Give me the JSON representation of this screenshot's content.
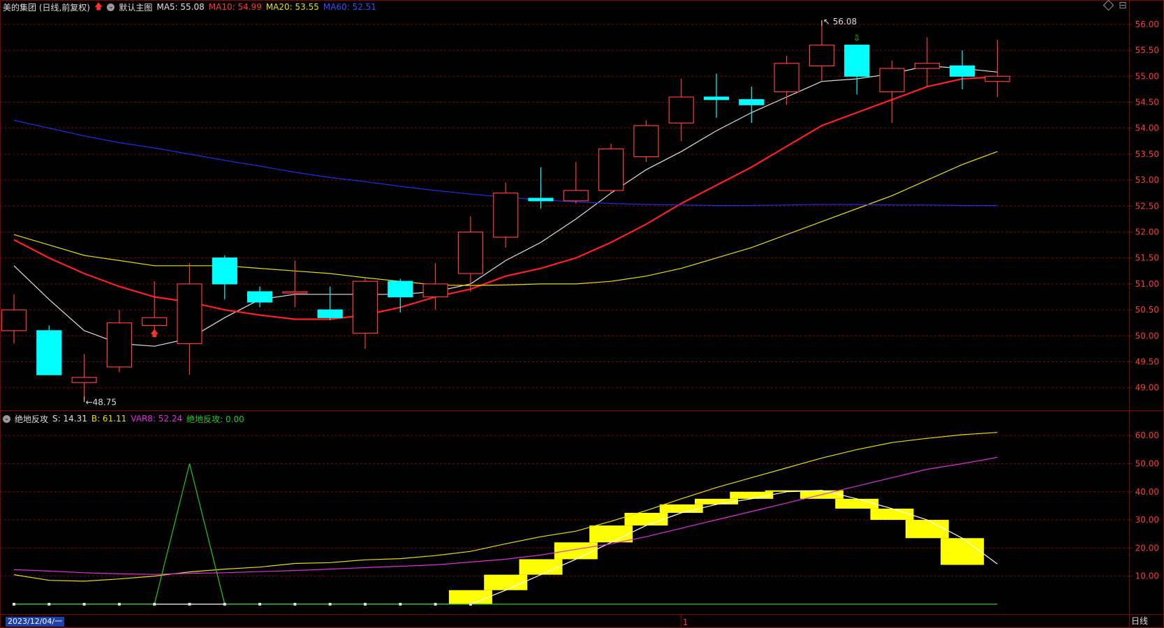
{
  "header": {
    "stock_name": "美的集团 (日线,前复权)",
    "template_name": "默认主图",
    "ma_labels": [
      {
        "text": "MA5: 55.08",
        "color": "#e0e0e0"
      },
      {
        "text": "MA10: 54.99",
        "color": "#ff2a2a"
      },
      {
        "text": "MA20: 53.55",
        "color": "#e8e000"
      },
      {
        "text": "MA60: 52.51",
        "color": "#2a3bff"
      }
    ]
  },
  "indicator_header": {
    "name": "绝地反攻",
    "labels": [
      {
        "text": "S: 14.31",
        "color": "#e0e0e0"
      },
      {
        "text": "B: 61.11",
        "color": "#e8e000"
      },
      {
        "text": "VAR8: 52.24",
        "color": "#e02ee0"
      },
      {
        "text": "绝地反攻: 0.00",
        "color": "#22cc22"
      }
    ]
  },
  "footer": {
    "date_label": "2023/12/04/一",
    "period_label": "日线",
    "divider_label": "1"
  },
  "colors": {
    "up": "#ff3b3b",
    "down": "#00ffff",
    "grid": "#8b0000",
    "axis_text": "#ff3b3b",
    "ma5": "#e0e0e0",
    "ma10": "#ff2020",
    "ma20": "#e8e000",
    "ma60": "#1e2ef0",
    "s_bars": "#ffff00",
    "b_line": "#e8e000",
    "var8": "#e02ee0",
    "jdfg": "#22cc22"
  },
  "chart_data": [
    {
      "type": "candlestick",
      "title": "美的集团 (日线,前复权)",
      "ylim": [
        48.7,
        56.2
      ],
      "yticks": [
        "49.00",
        "49.50",
        "50.00",
        "50.50",
        "51.00",
        "51.50",
        "52.00",
        "52.50",
        "53.00",
        "53.50",
        "54.00",
        "54.50",
        "55.00",
        "55.50",
        "56.00"
      ],
      "annotations": [
        {
          "text": "48.75",
          "x": 2,
          "y": 48.75,
          "kind": "low"
        },
        {
          "text": "56.08",
          "x": 23,
          "y": 56.08,
          "kind": "high"
        }
      ],
      "signals": [
        {
          "x": 4,
          "kind": "buy"
        },
        {
          "x": 24,
          "kind": "sell"
        }
      ],
      "candles": [
        {
          "o": 50.1,
          "h": 50.8,
          "l": 49.85,
          "c": 50.5
        },
        {
          "o": 50.1,
          "h": 50.2,
          "l": 49.25,
          "c": 49.25
        },
        {
          "o": 49.1,
          "h": 49.65,
          "l": 48.75,
          "c": 49.2
        },
        {
          "o": 49.4,
          "h": 50.5,
          "l": 49.3,
          "c": 50.25
        },
        {
          "o": 50.2,
          "h": 51.05,
          "l": 50.05,
          "c": 50.35
        },
        {
          "o": 49.85,
          "h": 51.4,
          "l": 49.25,
          "c": 51.0
        },
        {
          "o": 51.5,
          "h": 51.55,
          "l": 50.7,
          "c": 51.0
        },
        {
          "o": 50.85,
          "h": 50.95,
          "l": 50.55,
          "c": 50.65
        },
        {
          "o": 50.85,
          "h": 51.45,
          "l": 50.55,
          "c": 50.85
        },
        {
          "o": 50.5,
          "h": 50.95,
          "l": 50.3,
          "c": 50.35
        },
        {
          "o": 50.05,
          "h": 51.1,
          "l": 49.75,
          "c": 51.05
        },
        {
          "o": 51.05,
          "h": 51.1,
          "l": 50.45,
          "c": 50.75
        },
        {
          "o": 50.75,
          "h": 51.4,
          "l": 50.5,
          "c": 51.0
        },
        {
          "o": 51.2,
          "h": 52.3,
          "l": 50.85,
          "c": 52.0
        },
        {
          "o": 51.9,
          "h": 52.95,
          "l": 51.7,
          "c": 52.75
        },
        {
          "o": 52.65,
          "h": 53.25,
          "l": 52.45,
          "c": 52.6
        },
        {
          "o": 52.6,
          "h": 53.35,
          "l": 52.55,
          "c": 52.8
        },
        {
          "o": 52.8,
          "h": 53.7,
          "l": 52.75,
          "c": 53.6
        },
        {
          "o": 53.45,
          "h": 54.15,
          "l": 53.35,
          "c": 54.05
        },
        {
          "o": 54.1,
          "h": 54.95,
          "l": 53.75,
          "c": 54.6
        },
        {
          "o": 54.6,
          "h": 55.05,
          "l": 54.2,
          "c": 54.55
        },
        {
          "o": 54.55,
          "h": 54.8,
          "l": 54.1,
          "c": 54.45
        },
        {
          "o": 54.7,
          "h": 55.4,
          "l": 54.45,
          "c": 55.25
        },
        {
          "o": 55.2,
          "h": 56.08,
          "l": 54.9,
          "c": 55.6
        },
        {
          "o": 55.6,
          "h": 55.6,
          "l": 54.65,
          "c": 55.0
        },
        {
          "o": 54.7,
          "h": 55.3,
          "l": 54.1,
          "c": 55.15
        },
        {
          "o": 55.15,
          "h": 55.75,
          "l": 54.8,
          "c": 55.25
        },
        {
          "o": 55.2,
          "h": 55.5,
          "l": 54.75,
          "c": 55.0
        },
        {
          "o": 54.9,
          "h": 55.7,
          "l": 54.6,
          "c": 55.0
        }
      ],
      "series": [
        {
          "name": "MA5",
          "values": [
            51.35,
            50.7,
            50.1,
            49.85,
            49.8,
            49.95,
            50.35,
            50.7,
            50.8,
            50.8,
            50.8,
            50.8,
            50.85,
            51.0,
            51.45,
            51.8,
            52.25,
            52.75,
            53.2,
            53.55,
            53.95,
            54.3,
            54.6,
            54.9,
            54.95,
            55.05,
            55.2,
            55.15,
            55.08
          ]
        },
        {
          "name": "MA10",
          "values": [
            51.85,
            51.5,
            51.2,
            50.95,
            50.75,
            50.65,
            50.5,
            50.4,
            50.32,
            50.32,
            50.4,
            50.55,
            50.75,
            50.9,
            51.15,
            51.3,
            51.5,
            51.8,
            52.15,
            52.55,
            52.9,
            53.25,
            53.65,
            54.05,
            54.3,
            54.55,
            54.8,
            54.95,
            54.99
          ]
        },
        {
          "name": "MA20",
          "values": [
            51.95,
            51.75,
            51.55,
            51.45,
            51.35,
            51.35,
            51.35,
            51.3,
            51.25,
            51.2,
            51.12,
            51.05,
            50.98,
            50.97,
            50.98,
            51.0,
            51.0,
            51.05,
            51.15,
            51.3,
            51.5,
            51.7,
            51.95,
            52.2,
            52.45,
            52.7,
            53.0,
            53.3,
            53.55
          ]
        },
        {
          "name": "MA60",
          "values": [
            54.15,
            54.0,
            53.85,
            53.72,
            53.62,
            53.5,
            53.38,
            53.27,
            53.15,
            53.05,
            52.97,
            52.88,
            52.8,
            52.73,
            52.67,
            52.62,
            52.58,
            52.55,
            52.53,
            52.52,
            52.51,
            52.51,
            52.52,
            52.53,
            52.53,
            52.52,
            52.52,
            52.51,
            52.51
          ]
        }
      ]
    },
    {
      "type": "bar",
      "title": "绝地反攻",
      "ylim": [
        -3,
        66
      ],
      "yticks": [
        "10.00",
        "20.00",
        "30.00",
        "40.00",
        "50.00",
        "60.00"
      ],
      "s_bars": [
        {
          "from": 0,
          "to": 0
        },
        {
          "from": 0,
          "to": 0
        },
        {
          "from": 0,
          "to": 0
        },
        {
          "from": 0,
          "to": 0
        },
        {
          "from": 0,
          "to": 0
        },
        {
          "from": 0,
          "to": 0
        },
        {
          "from": 0,
          "to": 0
        },
        {
          "from": 0,
          "to": 0
        },
        {
          "from": 0,
          "to": 0
        },
        {
          "from": 0,
          "to": 0
        },
        {
          "from": 0,
          "to": 0
        },
        {
          "from": 0,
          "to": 0
        },
        {
          "from": 0,
          "to": 0
        },
        {
          "from": 0,
          "to": 5
        },
        {
          "from": 5,
          "to": 10.5
        },
        {
          "from": 10.5,
          "to": 16
        },
        {
          "from": 16,
          "to": 22
        },
        {
          "from": 22,
          "to": 28
        },
        {
          "from": 28,
          "to": 32.5
        },
        {
          "from": 32.5,
          "to": 35.5
        },
        {
          "from": 35.5,
          "to": 37.5
        },
        {
          "from": 37.5,
          "to": 40
        },
        {
          "from": 40,
          "to": 40.5
        },
        {
          "from": 40.5,
          "to": 37.5
        },
        {
          "from": 37.5,
          "to": 34
        },
        {
          "from": 34,
          "to": 30
        },
        {
          "from": 30,
          "to": 23.5
        },
        {
          "from": 23.5,
          "to": 14
        }
      ],
      "series": [
        {
          "name": "S",
          "values": [
            0,
            0,
            0,
            0,
            0,
            0,
            0,
            0,
            0,
            0,
            0,
            0,
            0,
            0,
            5,
            10.5,
            16,
            22,
            28,
            32.5,
            35.5,
            37.5,
            40,
            40.5,
            37.5,
            34,
            30,
            23.5,
            14.31
          ]
        },
        {
          "name": "B",
          "values": [
            10.5,
            8.5,
            8.2,
            9.0,
            10,
            11.5,
            12.5,
            13.2,
            14.5,
            14.8,
            15.8,
            16.2,
            17.3,
            18.8,
            21.5,
            24.0,
            26.0,
            29.5,
            33.3,
            37.5,
            41.5,
            45.0,
            48.5,
            52.0,
            55.0,
            57.5,
            59.0,
            60.3,
            61.11
          ]
        },
        {
          "name": "VAR8",
          "values": [
            12.3,
            11.8,
            11.2,
            10.8,
            10.6,
            11.0,
            11.2,
            11.6,
            12.0,
            12.5,
            13.0,
            13.5,
            14.0,
            15.0,
            16.0,
            17.5,
            19.5,
            21.5,
            24.0,
            27.0,
            30.0,
            33.0,
            36.0,
            39.0,
            42.0,
            45.0,
            48.0,
            50.0,
            52.24
          ]
        },
        {
          "name": "绝地反攻",
          "values": [
            0,
            0,
            0,
            0,
            0,
            50,
            0,
            0,
            0,
            0,
            0,
            0,
            0,
            0,
            0,
            0,
            0,
            0,
            0,
            0,
            0,
            0,
            0,
            0,
            0,
            0,
            0,
            0,
            0
          ]
        }
      ]
    }
  ]
}
